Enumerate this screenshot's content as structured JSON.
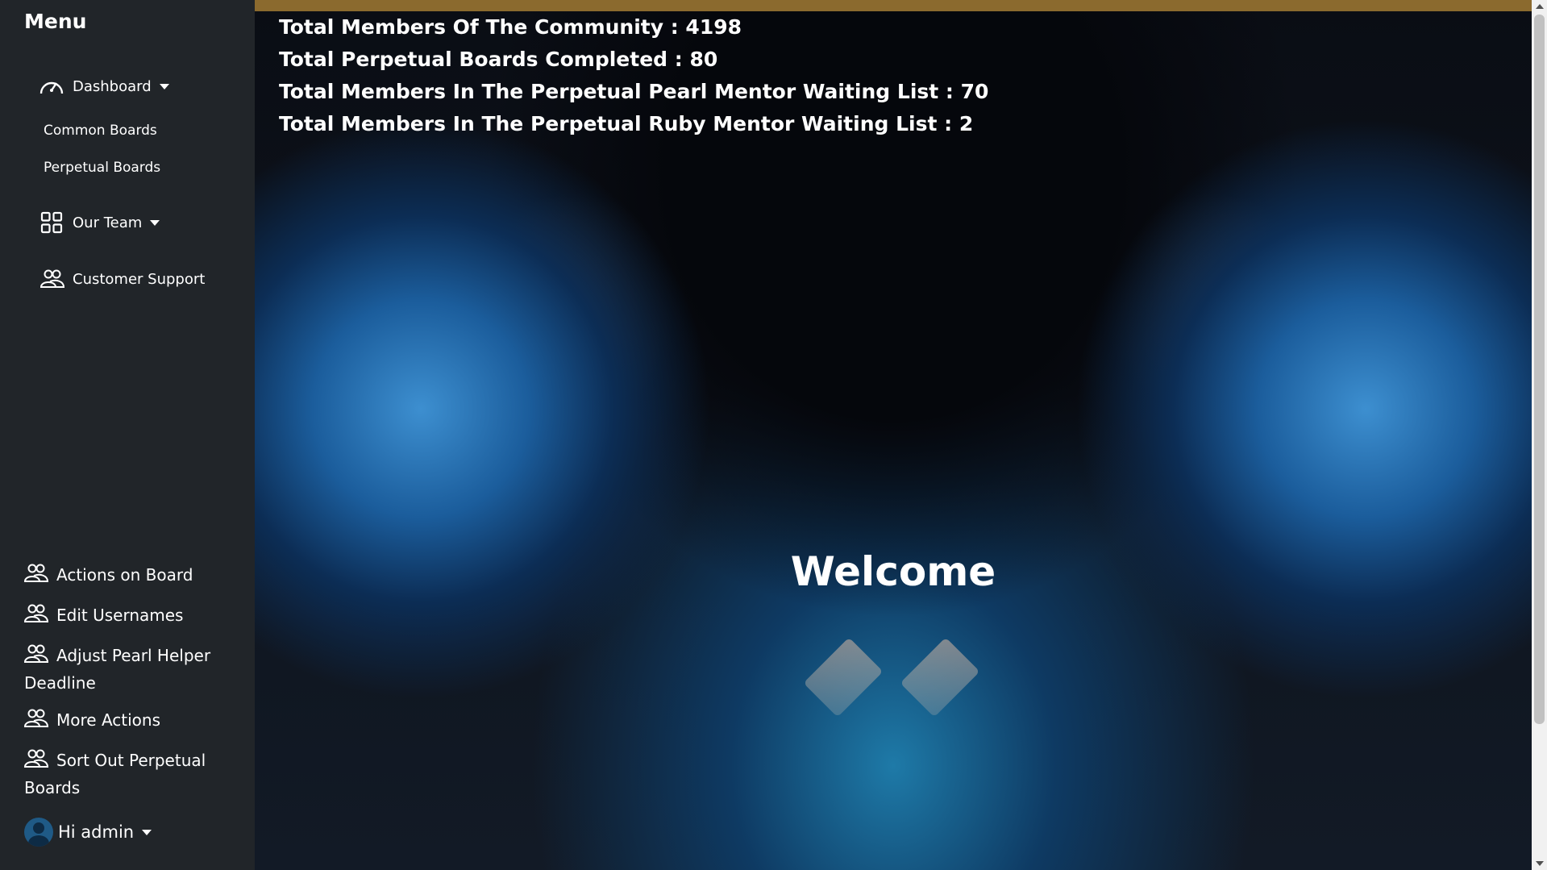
{
  "sidebar": {
    "menu_title": "Menu",
    "dashboard": {
      "label": "Dashboard",
      "icon": "speedometer-icon"
    },
    "sub_items": [
      "Common Boards",
      "Perpetual Boards"
    ],
    "our_team": {
      "label": "Our Team",
      "icon": "grid-icon"
    },
    "customer_support": {
      "label": "Customer Support",
      "icon": "people-icon"
    },
    "actions": [
      {
        "label": "Actions on Board",
        "icon": "people-icon"
      },
      {
        "label": "Edit Usernames",
        "icon": "people-icon"
      },
      {
        "label": "Adjust Pearl Helper Deadline",
        "icon": "people-icon"
      },
      {
        "label": "More Actions",
        "icon": "people-icon"
      },
      {
        "label": "Sort Out Perpetual Boards",
        "icon": "people-icon"
      }
    ],
    "user": {
      "greeting": "Hi admin",
      "icon": "avatar-icon"
    }
  },
  "main": {
    "stats": [
      "Total Members Of The Community : 4198",
      "Total Perpetual Boards Completed : 80",
      "Total Members In The Perpetual Pearl Mentor Waiting List : 70",
      "Total Members In The Perpetual Ruby Mentor Waiting List : 2"
    ],
    "welcome": "Welcome"
  },
  "colors": {
    "sidebar_bg": "#212529",
    "top_bar": "#8b6a2e",
    "text": "#ffffff"
  }
}
